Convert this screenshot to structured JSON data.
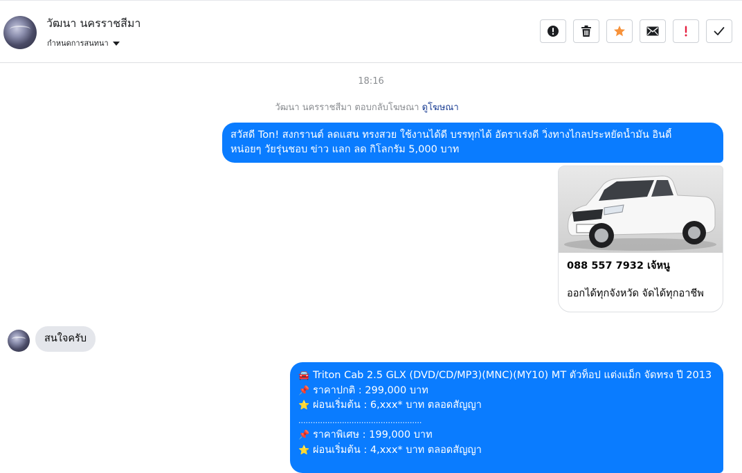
{
  "header": {
    "contact_name": "วัฒนา นครราชสีมา",
    "manage_label": "กำหนดการสนทนา",
    "toolbar": [
      {
        "name": "report-button",
        "icon": "alert-circle-icon"
      },
      {
        "name": "delete-button",
        "icon": "trash-icon"
      },
      {
        "name": "star-button",
        "icon": "star-icon"
      },
      {
        "name": "mark-unread-button",
        "icon": "envelope-icon"
      },
      {
        "name": "spam-button",
        "icon": "exclamation-icon"
      },
      {
        "name": "done-button",
        "icon": "check-icon"
      }
    ]
  },
  "conversation": {
    "timestamp": "18:16",
    "notice_text": "วัฒนา นครราชสีมา ตอบกลับโฆษณา",
    "notice_link": "ดูโฆษณา",
    "message_1_lines": [
      "สวัสดี Ton! สงกรานต์ ลดแสน ทรงสวย ใช้งานได้ดี บรรทุกได้ อัตราเร่งดี วิ่งทางไกลประหยัดน้ำมัน อินดี้",
      "หน่อยๆ วัยรุ่นชอบ ข่าว แลก ลด กิโลกรัม 5,000 บาท"
    ],
    "ad_card": {
      "image": "white-pickup-truck-photo",
      "title": "088 557 7932 เจ้หนู",
      "subtitle": "ออกได้ทุกจังหวัด จัดได้ทุกอาชีพ"
    },
    "incoming_message": "สนใจครับ",
    "message_2_rows": [
      {
        "icon": "car-icon",
        "emoji": "🚘",
        "text": "Triton Cab 2.5 GLX (DVD/CD/MP3)(MNC)(MY10) MT ตัวท็อป แต่งแม็ก จัดทรง ปี 2013"
      },
      {
        "icon": "pushpin-icon",
        "emoji": "📌",
        "text": "ราคาปกติ : 299,000 บาท"
      },
      {
        "icon": "star-icon",
        "emoji": "⭐",
        "text": "ผ่อนเริ่มต้น : 6,xxx* บาท ตลอดสัญญา"
      },
      {
        "icon": "",
        "emoji": "",
        "text": "..................................................."
      },
      {
        "icon": "pushpin-icon",
        "emoji": "📌",
        "text": "ราคาพิเศษ : 199,000 บาท"
      },
      {
        "icon": "star-icon",
        "emoji": "⭐",
        "text": "ผ่อนเริ่มต้น : 4,xxx* บาท ตลอดสัญญา"
      }
    ]
  },
  "colors": {
    "outgoing_bubble": "#0a7cff",
    "incoming_bubble": "#e4e6eb",
    "star_accent": "#f7923a",
    "spam_accent": "#e41e3f",
    "link": "#1c3f94"
  }
}
